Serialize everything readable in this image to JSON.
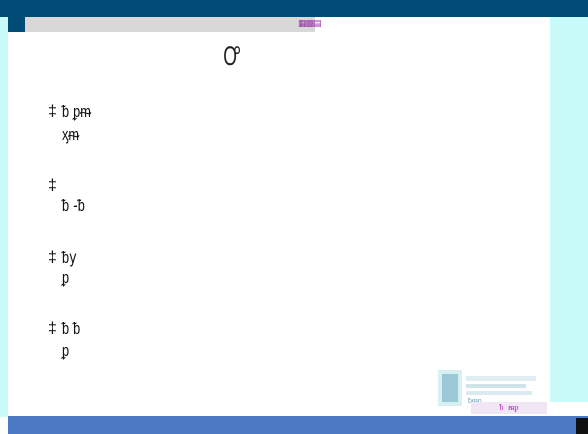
{
  "window": {
    "toolbar_glyph": "▦▩▤"
  },
  "slide": {
    "title": "Ꝍ",
    "bullets": [
      {
        "marker": "‡",
        "line1": "ᵬ     ᵱᵯ",
        "line2": "ᶍᵯ"
      },
      {
        "marker": "‡",
        "line1": "",
        "line2": "ᵬ                       -ᵬ"
      },
      {
        "marker": "‡",
        "line1": "ᵬy",
        "line2": "ᵱ"
      },
      {
        "marker": "‡",
        "line1": "ᵬ      ᵬ",
        "line2": "ᵱ"
      }
    ]
  },
  "footer": {
    "logo_text": "ᵬᵯᵱ",
    "chip_text": "ᵬ ᵯᵱ"
  },
  "colors": {
    "title_bar": "#004c77",
    "side_panel": "#c9fbfb",
    "bottom_bar": "#4c79c3",
    "footer_chip_text": "#b12fc0"
  }
}
